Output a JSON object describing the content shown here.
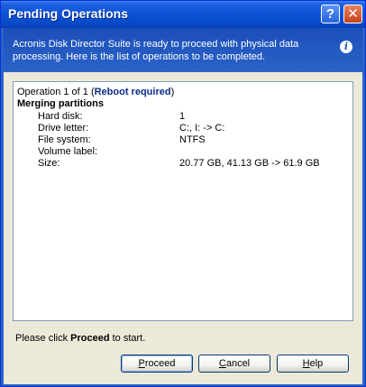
{
  "window": {
    "title": "Pending Operations",
    "help_glyph": "?",
    "close_glyph": "✕"
  },
  "header": {
    "message": "Acronis Disk Director Suite is ready to proceed with physical data processing. Here is the list of operations to be completed.",
    "icon": "info-icon"
  },
  "operation": {
    "counter_prefix": "Operation 1 of 1 (",
    "reboot_text": "Reboot required",
    "counter_suffix": ")",
    "title": "Merging partitions",
    "properties": [
      {
        "label": "Hard disk:",
        "value": "1"
      },
      {
        "label": "Drive letter:",
        "value": "C:, I: -> C:"
      },
      {
        "label": "File system:",
        "value": "NTFS"
      },
      {
        "label": "Volume label:",
        "value": ""
      },
      {
        "label": "Size:",
        "value": "20.77 GB, 41.13 GB -> 61.9 GB"
      }
    ]
  },
  "footer": {
    "prefix": "Please click ",
    "emphasis": "Proceed",
    "suffix": " to start."
  },
  "buttons": {
    "proceed_acc": "P",
    "proceed_rest": "roceed",
    "cancel_acc": "C",
    "cancel_rest": "ancel",
    "help_acc": "H",
    "help_rest": "elp"
  },
  "colors": {
    "titlebar": "#0a52d6",
    "header_band": "#2459be",
    "dialog_face": "#ece9d8",
    "reboot_link": "#0a2a8a"
  }
}
